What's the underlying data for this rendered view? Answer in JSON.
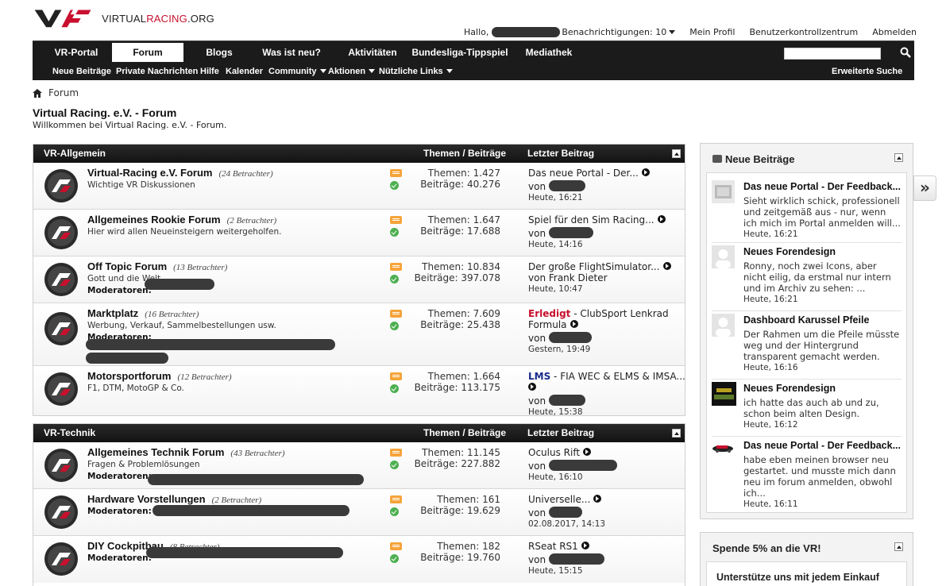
{
  "logo": {
    "text_a": "VIRTUAL",
    "text_b": "RACING",
    "text_c": ".ORG"
  },
  "userbar": {
    "greeting": "Hallo,",
    "notifications": "Benachrichtigungen: 10",
    "links": [
      "Mein Profil",
      "Benutzerkontrollzentrum",
      "Abmelden"
    ]
  },
  "nav": {
    "tabs": [
      "VR-Portal",
      "Forum",
      "Blogs",
      "Was ist neu?",
      "Aktivitäten",
      "Bundesliga-Tippspiel",
      "Mediathek"
    ],
    "active_tab": "Forum",
    "sub": [
      "Neue Beiträge",
      "Private Nachrichten",
      "Hilfe",
      "Kalender",
      "Community",
      "Aktionen",
      "Nützliche Links"
    ],
    "advanced_search": "Erweiterte Suche"
  },
  "breadcrumb": "Forum",
  "page": {
    "title": "Virtual Racing. e.V. - Forum",
    "subtitle": "Willkommen bei Virtual Racing. e.V. - Forum."
  },
  "columns": {
    "stats": "Themen / Beiträge",
    "last": "Letzter Beitrag"
  },
  "sections": [
    {
      "title": "VR-Allgemein",
      "forums": [
        {
          "name": "Virtual-Racing e.V. Forum",
          "viewers": "(24 Betrachter)",
          "desc": "Wichtige VR Diskussionen",
          "mods": "",
          "themen": "Themen: 1.427",
          "beitraege": "Beiträge: 40.276",
          "last_prefix": "",
          "last_title": "Das neue Portal - Der...",
          "last_by": "von",
          "last_time": "Heute, 16:21"
        },
        {
          "name": "Allgemeines Rookie Forum",
          "viewers": "(2 Betrachter)",
          "desc": "Hier wird allen Neueinsteigern weitergeholfen.",
          "mods": "",
          "themen": "Themen: 1.647",
          "beitraege": "Beiträge: 17.688",
          "last_prefix": "",
          "last_title": "Spiel für den Sim Racing...",
          "last_by": "von",
          "last_time": "Heute, 14:16"
        },
        {
          "name": "Off Topic Forum",
          "viewers": "(13 Betrachter)",
          "desc": "Gott und die Welt",
          "mods": "Moderatoren:",
          "themen": "Themen: 10.834",
          "beitraege": "Beiträge: 397.078",
          "last_prefix": "",
          "last_title": "Der große FlightSimulator...",
          "last_by": "von Frank Dieter",
          "last_time": "Heute, 10:47"
        },
        {
          "name": "Marktplatz",
          "viewers": "(16 Betrachter)",
          "desc": "Werbung, Verkauf, Sammelbestellungen usw.",
          "mods": "Moderatoren:",
          "themen": "Themen: 7.609",
          "beitraege": "Beiträge: 25.438",
          "last_prefix": "Erledigt",
          "last_title": " - ClubSport Lenkrad Formula",
          "last_by": "von",
          "last_time": "Gestern, 19:49"
        },
        {
          "name": "Motorsportforum",
          "viewers": "(12 Betrachter)",
          "desc": "F1, DTM, MotoGP & Co.",
          "mods": "",
          "themen": "Themen: 1.664",
          "beitraege": "Beiträge: 113.175",
          "last_prefix": "LMS",
          "last_title": " - FIA WEC & ELMS & IMSA...",
          "last_by": "von",
          "last_time": "Heute, 15:38"
        }
      ]
    },
    {
      "title": "VR-Technik",
      "forums": [
        {
          "name": "Allgemeines Technik Forum",
          "viewers": "(43 Betrachter)",
          "desc": "Fragen & Problemlösungen",
          "mods": "Moderatoren:",
          "themen": "Themen: 11.145",
          "beitraege": "Beiträge: 227.882",
          "last_prefix": "",
          "last_title": "Oculus Rift",
          "last_by": "von",
          "last_time": "Heute, 16:10"
        },
        {
          "name": "Hardware Vorstellungen",
          "viewers": "(2 Betrachter)",
          "desc": "",
          "mods": "Moderatoren:",
          "themen": "Themen: 161",
          "beitraege": "Beiträge: 19.629",
          "last_prefix": "",
          "last_title": "Universelle...",
          "last_by": "von",
          "last_time": "02.08.2017, 14:13"
        },
        {
          "name": "DIY Cockpitbau",
          "viewers": "(8 Betrachter)",
          "desc": "",
          "mods": "Moderatoren:",
          "themen": "Themen: 182",
          "beitraege": "Beiträge: 19.760",
          "last_prefix": "",
          "last_title": "RSeat RS1",
          "last_by": "von",
          "last_time": "Heute, 15:15"
        }
      ]
    }
  ],
  "sidebar": {
    "title": "Neue Beiträge",
    "items": [
      {
        "title": "Das neue Portal - Der Feedback...",
        "text": "Sieht wirklich schick, professionell und zeitgemäß aus - nur, wenn ich mich im Portal anmelden will...",
        "time": "Heute, 16:21"
      },
      {
        "title": "Neues Forendesign",
        "text": "Ronny, noch zwei Icons, aber nicht eilig, da erstmal nur intern und im Archiv zu sehen: ...",
        "time": "Heute, 16:21"
      },
      {
        "title": "Dashboard Karussel Pfeile",
        "text": "Der Rahmen um die Pfeile müsste weg und der Hintergrund transparent gemacht werden.",
        "time": "Heute, 16:16"
      },
      {
        "title": "Neues Forendesign",
        "text": "ich hatte das auch ab und zu, schon beim alten Design.",
        "time": "Heute, 16:12"
      },
      {
        "title": "Das neue Portal - Der Feedback...",
        "text": "habe eben meinen browser neu gestartet. und musste mich dann neu im forum anmelden, obwohl ich...",
        "time": "Heute, 16:11"
      }
    ]
  },
  "donate": {
    "title": "Spende 5% an die VR!",
    "text": "Unterstütze uns mit jedem Einkauf"
  },
  "colors": {
    "nav_bg": "#1b1b1b",
    "brand_red": "#c8102e",
    "prefix_blue": "#1a2a8a"
  }
}
